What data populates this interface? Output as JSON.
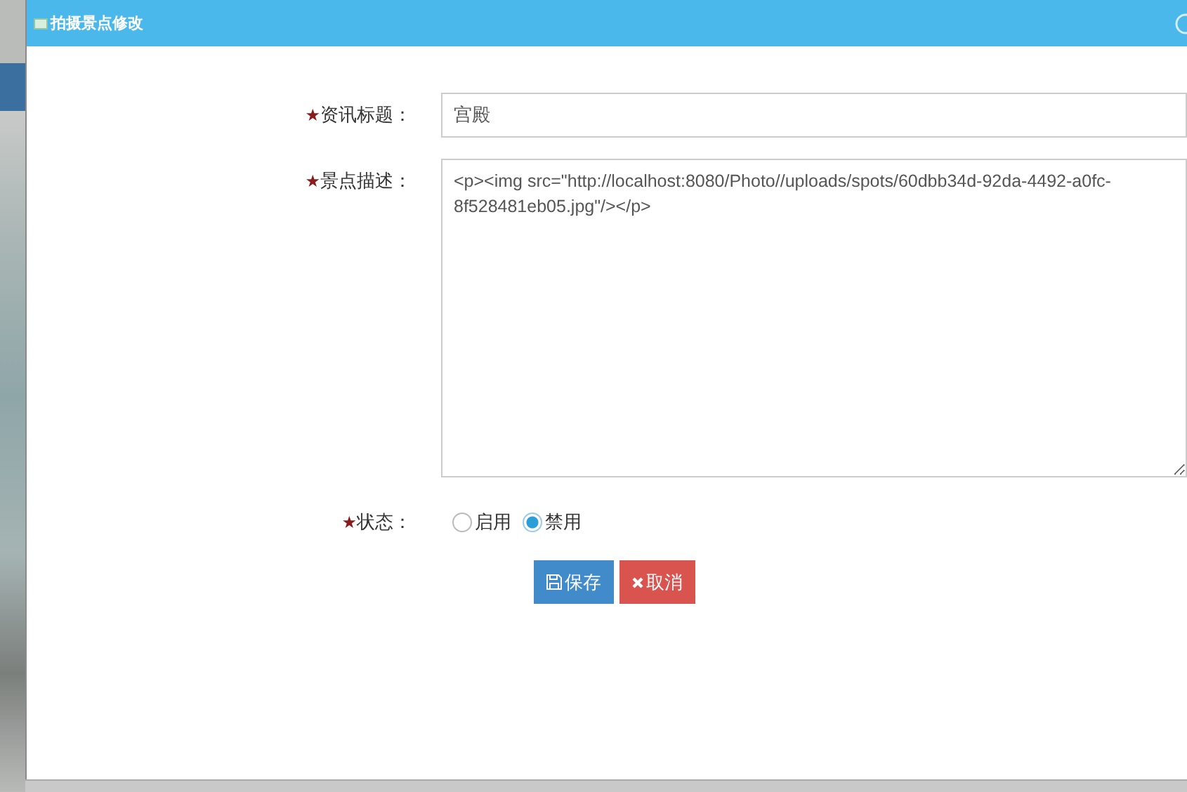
{
  "dialog": {
    "title": "拍摄景点修改"
  },
  "fields": [
    {
      "kind": "text",
      "required_mark": "★",
      "label": "资讯标题：",
      "value": "宫殿"
    },
    {
      "kind": "textarea",
      "required_mark": "★",
      "label": "景点描述：",
      "value": "<p><img src=\"http://localhost:8080/Photo//uploads/spots/60dbb34d-92da-4492-a0fc-8f528481eb05.jpg\"/></p>"
    },
    {
      "kind": "radio",
      "required_mark": "★",
      "label": "状态：",
      "options": [
        {
          "label": "启用",
          "selected": false
        },
        {
          "label": "禁用",
          "selected": true
        }
      ]
    }
  ],
  "buttons": [
    {
      "kind": "save",
      "label": "保存"
    },
    {
      "kind": "cancel",
      "label": "取消"
    }
  ]
}
